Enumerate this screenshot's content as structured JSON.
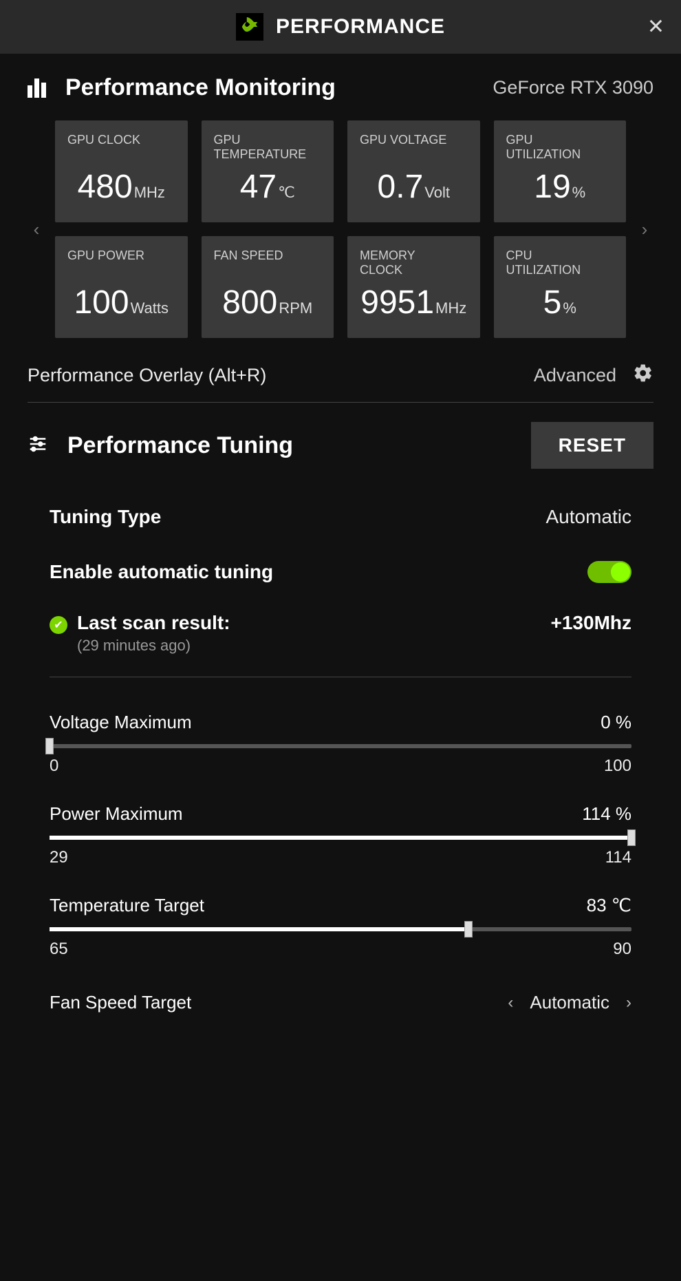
{
  "header": {
    "title": "PERFORMANCE"
  },
  "monitoring": {
    "title": "Performance Monitoring",
    "gpu_name": "GeForce RTX 3090",
    "tiles": [
      {
        "label": "GPU CLOCK",
        "value": "480",
        "unit": "MHz"
      },
      {
        "label": "GPU\nTEMPERATURE",
        "value": "47",
        "unit": "℃"
      },
      {
        "label": "GPU VOLTAGE",
        "value": "0.7",
        "unit": "Volt"
      },
      {
        "label": "GPU\nUTILIZATION",
        "value": "19",
        "unit": "%"
      },
      {
        "label": "GPU POWER",
        "value": "100",
        "unit": "Watts"
      },
      {
        "label": "FAN SPEED",
        "value": "800",
        "unit": "RPM"
      },
      {
        "label": "MEMORY\nCLOCK",
        "value": "9951",
        "unit": "MHz"
      },
      {
        "label": "CPU\nUTILIZATION",
        "value": "5",
        "unit": "%"
      }
    ]
  },
  "overlay": {
    "label": "Performance Overlay (Alt+R)",
    "mode": "Advanced"
  },
  "tuning": {
    "title": "Performance Tuning",
    "reset_label": "RESET",
    "type_label": "Tuning Type",
    "type_value": "Automatic",
    "auto_label": "Enable automatic tuning",
    "auto_enabled": true,
    "scan": {
      "label": "Last scan result:",
      "age": "(29 minutes ago)",
      "value": "+130Mhz"
    },
    "sliders": {
      "voltage": {
        "label": "Voltage Maximum",
        "value": "0 %",
        "min": "0",
        "max": "100",
        "pct": 0
      },
      "power": {
        "label": "Power Maximum",
        "value": "114 %",
        "min": "29",
        "max": "114",
        "pct": 100
      },
      "temp": {
        "label": "Temperature Target",
        "value": "83 ℃",
        "min": "65",
        "max": "90",
        "pct": 72
      }
    },
    "fan": {
      "label": "Fan Speed Target",
      "value": "Automatic"
    }
  }
}
